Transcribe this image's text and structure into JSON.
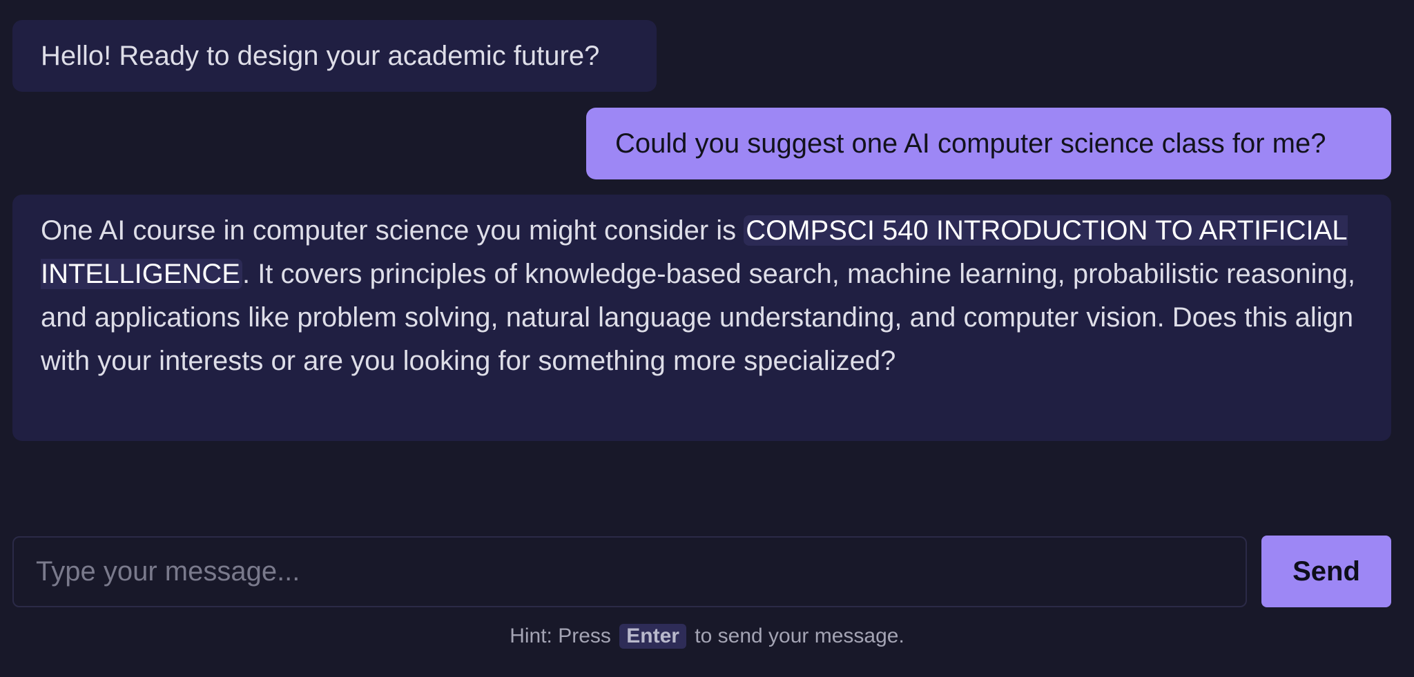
{
  "chat": {
    "greeting": "Hello! Ready to design your academic future?",
    "user_question": "Could you suggest one AI computer science class for me?",
    "answer": {
      "intro": "One AI course in computer science you might consider is ",
      "course": "COMPSCI 540 INTRODUCTION TO ARTIFICIAL INTELLIGENCE",
      "rest": ". It covers principles of knowledge-based search, machine learning, probabilistic reasoning, and applications like problem solving, natural language understanding, and computer vision. Does this align with your interests or are you looking for something more specialized?"
    }
  },
  "composer": {
    "placeholder": "Type your message...",
    "value": "",
    "send_label": "Send"
  },
  "hint": {
    "before": "Hint: Press",
    "key": "Enter",
    "after": "to send your message."
  },
  "colors": {
    "background": "#181829",
    "bot_bubble": "#201f42",
    "user_bubble": "#9d87f5",
    "accent": "#9d87f5"
  }
}
